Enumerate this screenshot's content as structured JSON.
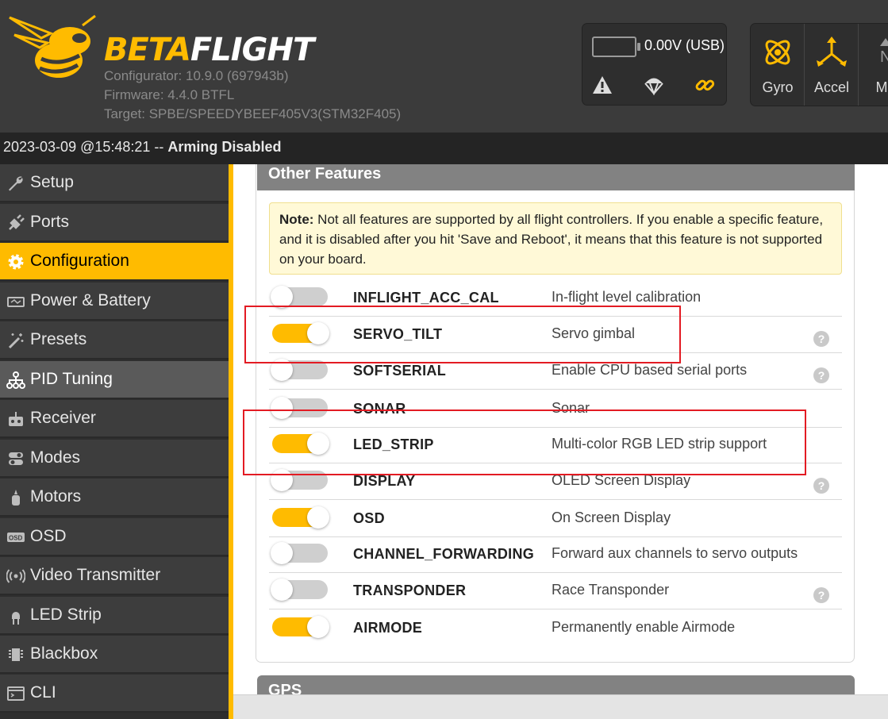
{
  "header": {
    "brand_part1": "BETA",
    "brand_part2": "FLIGHT",
    "configurator": "Configurator: 10.9.0 (697943b)",
    "firmware": "Firmware: 4.4.0 BTFL",
    "target": "Target: SPBE/SPEEDYBEEF405V3(STM32F405)",
    "voltage": "0.00V (USB)",
    "status_icons": [
      "warning-icon",
      "parachute-icon",
      "link-icon"
    ],
    "sensors": [
      {
        "label": "Gyro",
        "icon": "gyro-icon"
      },
      {
        "label": "Accel",
        "icon": "accel-icon"
      },
      {
        "label": "Ma",
        "icon": "mag-icon"
      }
    ],
    "accent_color": "#ffbb00"
  },
  "log": {
    "timestamp": "2023-03-09 @15:48:21 --",
    "status": "Arming Disabled"
  },
  "sidebar": {
    "items": [
      {
        "label": "Setup",
        "icon": "wrench-icon"
      },
      {
        "label": "Ports",
        "icon": "plug-icon"
      },
      {
        "label": "Configuration",
        "icon": "gear-icon"
      },
      {
        "label": "Power & Battery",
        "icon": "battery-icon"
      },
      {
        "label": "Presets",
        "icon": "magic-wand-icon"
      },
      {
        "label": "PID Tuning",
        "icon": "hierarchy-icon"
      },
      {
        "label": "Receiver",
        "icon": "receiver-icon"
      },
      {
        "label": "Modes",
        "icon": "toggles-icon"
      },
      {
        "label": "Motors",
        "icon": "motor-icon"
      },
      {
        "label": "OSD",
        "icon": "osd-icon"
      },
      {
        "label": "Video Transmitter",
        "icon": "antenna-icon"
      },
      {
        "label": "LED Strip",
        "icon": "led-icon"
      },
      {
        "label": "Blackbox",
        "icon": "blackbox-icon"
      },
      {
        "label": "CLI",
        "icon": "terminal-icon"
      }
    ],
    "active": "Configuration"
  },
  "panel": {
    "title": "Other Features",
    "note_label": "Note:",
    "note_text": " Not all features are supported by all flight controllers. If you enable a specific feature, and it is disabled after you hit 'Save and Reboot', it means that this feature is not supported on your board.",
    "features": [
      {
        "name": "INFLIGHT_ACC_CAL",
        "desc": "In-flight level calibration",
        "enabled": false,
        "help": false
      },
      {
        "name": "SERVO_TILT",
        "desc": "Servo gimbal",
        "enabled": true,
        "help": true
      },
      {
        "name": "SOFTSERIAL",
        "desc": "Enable CPU based serial ports",
        "enabled": false,
        "help": true
      },
      {
        "name": "SONAR",
        "desc": "Sonar",
        "enabled": false,
        "help": false
      },
      {
        "name": "LED_STRIP",
        "desc": "Multi-color RGB LED strip support",
        "enabled": true,
        "help": false
      },
      {
        "name": "DISPLAY",
        "desc": "OLED Screen Display",
        "enabled": false,
        "help": true
      },
      {
        "name": "OSD",
        "desc": "On Screen Display",
        "enabled": true,
        "help": false
      },
      {
        "name": "CHANNEL_FORWARDING",
        "desc": "Forward aux channels to servo outputs",
        "enabled": false,
        "help": false
      },
      {
        "name": "TRANSPONDER",
        "desc": "Race Transponder",
        "enabled": false,
        "help": true
      },
      {
        "name": "AIRMODE",
        "desc": "Permanently enable Airmode",
        "enabled": true,
        "help": false
      }
    ],
    "help_glyph": "?"
  },
  "gps": {
    "title": "GPS"
  }
}
